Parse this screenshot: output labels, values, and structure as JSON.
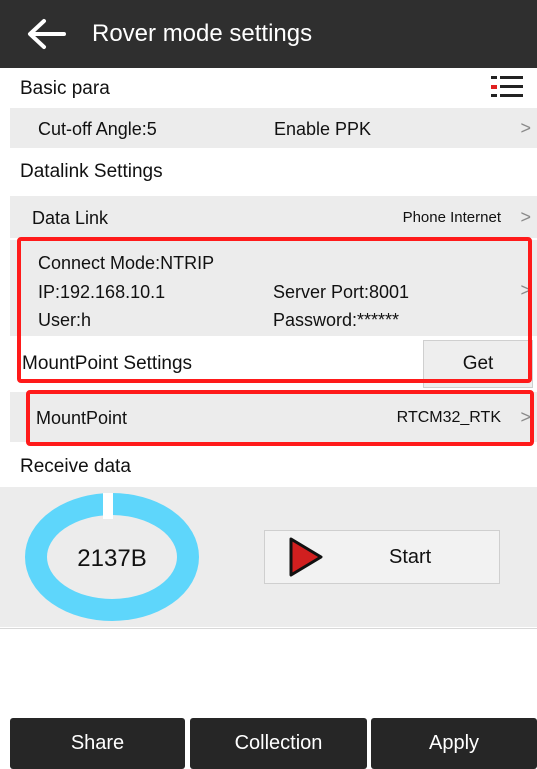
{
  "header": {
    "title": "Rover mode settings",
    "back_icon": "arrow-left-icon"
  },
  "basic_para": {
    "title": "Basic para",
    "menu_icon": "list-icon",
    "cutoff_angle": "Cut-off Angle:5",
    "enable_ppk": "Enable PPK"
  },
  "datalink_settings": {
    "title": "Datalink Settings",
    "data_link_label": "Data Link",
    "data_link_value": "Phone Internet",
    "connect_mode": "Connect Mode:NTRIP",
    "ip": "IP:192.168.10.1",
    "server_port": "Server Port:8001",
    "user": "User:h",
    "password": "Password:******"
  },
  "mountpoint_settings": {
    "title": "MountPoint Settings",
    "get_label": "Get",
    "mountpoint_label": "MountPoint",
    "mountpoint_value": "RTCM32_RTK"
  },
  "receive_data": {
    "title": "Receive data",
    "bytes": "2137B",
    "start_label": "Start",
    "ring_color": "#5ed6fb"
  },
  "footer": {
    "share": "Share",
    "collection": "Collection",
    "apply": "Apply"
  },
  "colors": {
    "highlight_border": "#ff1a1a",
    "titlebar": "#2f2f2f",
    "play_icon": "#d11f1f"
  }
}
